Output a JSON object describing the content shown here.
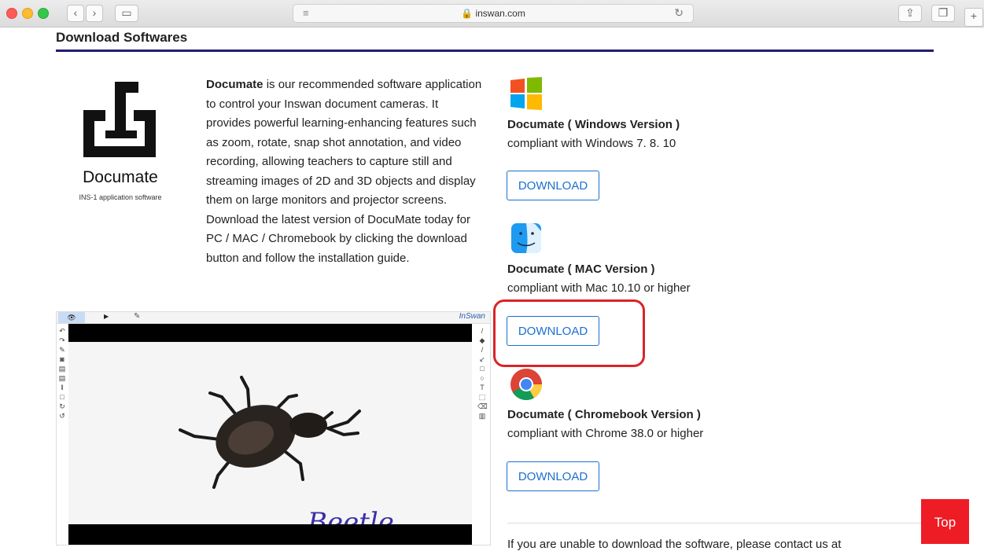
{
  "browser": {
    "domain": "inswan.com",
    "lock_icon": "lock-icon",
    "reader_icon": "reader-lines-icon",
    "reload_icon": "reload-icon"
  },
  "page": {
    "section_title": "Download Softwares",
    "logo_name": "Documate",
    "logo_sub": "INS-1 application software",
    "desc_bold": "Documate",
    "desc_rest": " is our recommended software application to control your Inswan document cameras. It provides powerful learning-enhancing features such as zoom, rotate, snap shot annotation, and video recording, allowing teachers to capture still and streaming images of 2D and 3D objects and display them on large monitors and projector screens. Download the latest version of DocuMate today for PC / MAC / Chromebook by clicking the download button and follow the installation guide.",
    "app_brand": "InSwan",
    "beetle_label": "Beetle.",
    "versions": [
      {
        "title": "Documate ( Windows Version )",
        "sub": "compliant with Windows 7. 8. 10",
        "button": "DOWNLOAD"
      },
      {
        "title": "Documate ( MAC Version )",
        "sub": "compliant with Mac 10.10 or higher",
        "button": "DOWNLOAD"
      },
      {
        "title": "Documate ( Chromebook Version )",
        "sub": "compliant with Chrome 38.0 or higher",
        "button": "DOWNLOAD"
      }
    ],
    "bottom_text": "If you are unable to download the software, please contact us at",
    "top_button": "Top"
  },
  "colors": {
    "accent": "#1b6fd0",
    "rule": "#201c6e",
    "highlight": "#d9242a",
    "top_button": "#ee1c25"
  }
}
